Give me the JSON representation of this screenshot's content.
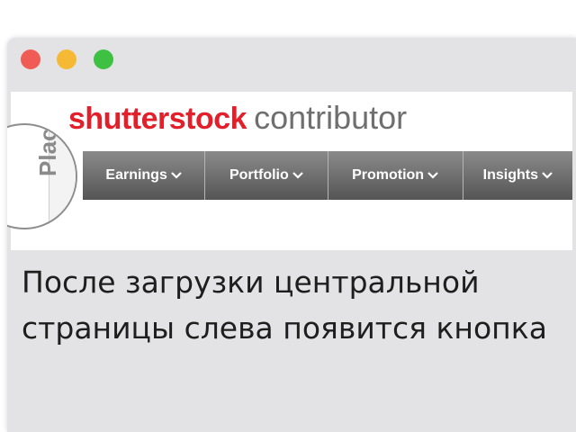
{
  "window": {
    "buttons": [
      "close",
      "minimize",
      "maximize"
    ]
  },
  "logo": {
    "brand": "shutterstock",
    "subtitle": "contributor"
  },
  "nav": {
    "items": [
      {
        "label": "Earnings",
        "icon": "chevron-down-icon"
      },
      {
        "label": "Portfolio",
        "icon": "chevron-down-icon"
      },
      {
        "label": "Promotion",
        "icon": "chevron-down-icon"
      },
      {
        "label": "Insights",
        "icon": "chevron-down-icon"
      }
    ]
  },
  "places_button": {
    "label": "Places"
  },
  "caption": {
    "text": "После загрузки центральной страницы слева появится кнопка"
  },
  "colors": {
    "brand_red": "#e2202b",
    "nav_top": "#8a8a8a",
    "nav_bottom": "#555555",
    "window_bg": "#e3e2e4",
    "close": "#f05c55",
    "minimize": "#f5b935",
    "maximize": "#3ec042"
  }
}
